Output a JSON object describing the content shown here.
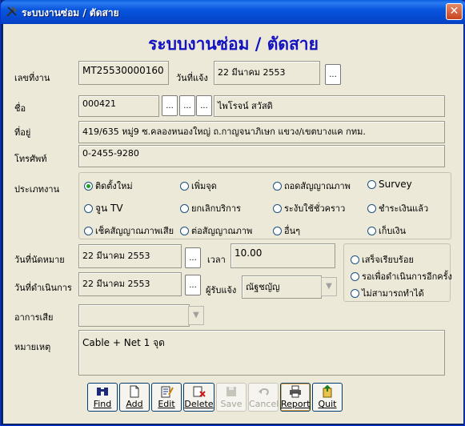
{
  "window": {
    "title": "ระบบงานซ่อม / ตัดสาย"
  },
  "form": {
    "heading": "ระบบงานซ่อม / ตัดสาย",
    "job_no": {
      "label": "เลขที่งาน",
      "value": "MT25530000160"
    },
    "notify_date": {
      "label": "วันที่แจ้ง",
      "value": "22 มีนาคม 2553"
    },
    "name": {
      "label": "ชื่อ",
      "code": "000421",
      "value": "ไพโรจน์ สวัสดิ"
    },
    "address": {
      "label": "ที่อยู่",
      "value": "419/635 หมู่9 ซ.คลองหนองใหญ่ ถ.กาญจนาภิเษก แขวง/เขตบางแค กทม."
    },
    "phone": {
      "label": "โทรศัพท์",
      "value": "0-2455-9280"
    },
    "job_type": {
      "label": "ประเภทงาน",
      "options": [
        "ติดตั้งใหม่",
        "เพิ่มจุด",
        "ถอดสัญญาณภาพ",
        "Survey",
        "จูน TV",
        "ยกเลิกบริการ",
        "ระงับใช้ชั่วคราว",
        "ชำระเงินแล้ว",
        "เช็คสัญญาณภาพเสีย",
        "ต่อสัญญาณภาพ",
        "อื่นๆ",
        "เก็บเงิน"
      ],
      "selected": "ติดตั้งใหม่"
    },
    "appointment_date": {
      "label": "วันที่นัดหมาย",
      "value": "22 มีนาคม 2553"
    },
    "time": {
      "label": "เวลา",
      "value": "10.00"
    },
    "operation_date": {
      "label": "วันที่ดำเนินการ",
      "value": "22 มีนาคม 2553"
    },
    "receiver": {
      "label": "ผู้รับแจ้ง",
      "value": "ณัฐชญัญ"
    },
    "status": {
      "options": [
        "เสร็จเรียบร้อย",
        "รอเพื่อดำเนินการอีกครั้ง",
        "ไม่สามารถทำได้"
      ]
    },
    "symptom": {
      "label": "อาการเสีย",
      "value": ""
    },
    "note": {
      "label": "หมายเหตุ",
      "value": "Cable + Net 1 จุด"
    },
    "dots": "..."
  },
  "toolbar": {
    "find": "Find",
    "add": "Add",
    "edit": "Edit",
    "delete": "Delete",
    "save": "Save",
    "cancel": "Cancel",
    "report": "Report",
    "quit": "Quit"
  },
  "colors": {
    "heading": "#1212c0",
    "titlebar": "#0855dd"
  }
}
